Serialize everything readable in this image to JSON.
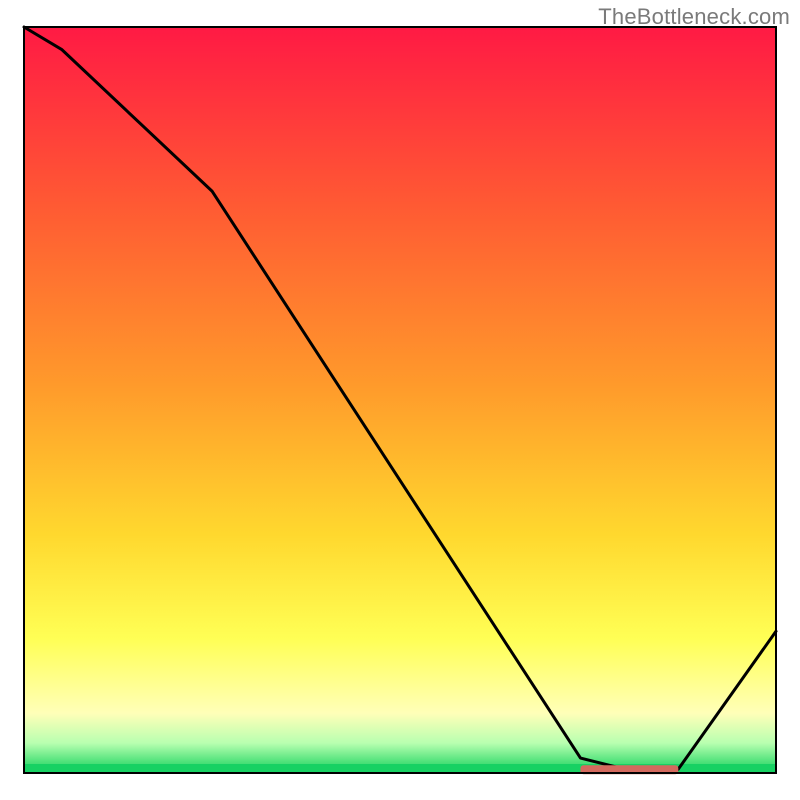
{
  "watermark": "TheBottleneck.com",
  "colors": {
    "red_top": "#ff1a44",
    "orange": "#ff8a2b",
    "yellow": "#ffe62e",
    "pale_yellow": "#ffffb0",
    "green_band_light": "#6bff8a",
    "green_band": "#17d163",
    "line": "#000000",
    "marker": "#d46a5e",
    "border": "#000000"
  },
  "chart_data": {
    "type": "line",
    "title": "",
    "xlabel": "",
    "ylabel": "",
    "xlim": [
      0,
      100
    ],
    "ylim": [
      0,
      100
    ],
    "x": [
      0,
      5,
      25,
      74,
      80,
      87,
      100
    ],
    "values": [
      100,
      97,
      78,
      2,
      0.5,
      0.5,
      19
    ],
    "flat_marker": {
      "x_start": 74,
      "x_end": 87,
      "y": 0.5
    },
    "notes": "Gradient heatmap background from red (top) through orange, yellow, pale-yellow to a thin green strip at the bottom. A black polyline descends from top-left, has a slight knee around x≈25, reaches a flat minimum near y≈0 between x≈74–87 where a small salmon-colored horizontal marker sits, then rises toward the right edge. No axes, ticks, or labels are shown."
  }
}
